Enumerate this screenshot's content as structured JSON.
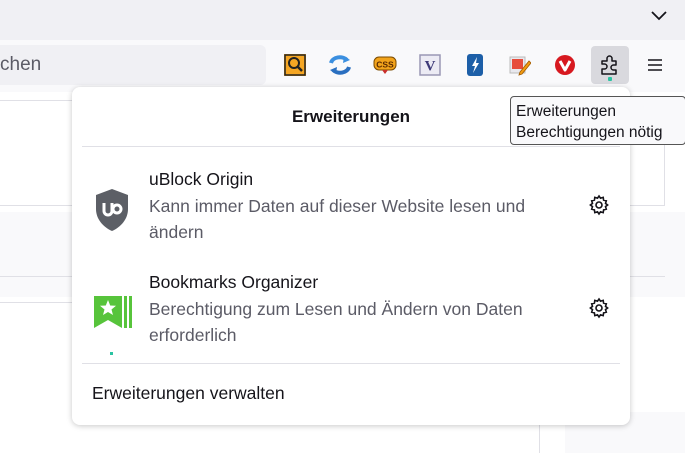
{
  "urlbar": {
    "placeholder": "chen"
  },
  "toolbar": {
    "icons": [
      "magnifier-extension-icon",
      "sync-arrows-icon",
      "css-extension-icon",
      "v-extension-icon",
      "bolt-extension-icon",
      "edit-extension-icon",
      "vivaldi-extension-icon",
      "puzzle-piece-icon",
      "hamburger-menu-icon"
    ]
  },
  "panel": {
    "title": "Erweiterungen",
    "extensions": [
      {
        "name": "uBlock Origin",
        "description": "Kann immer Daten auf dieser Website lesen und ändern",
        "icon": "ublock-shield-icon"
      },
      {
        "name": "Bookmarks Organizer",
        "description": "Berechtigung zum Lesen und Ändern von Daten erforderlich",
        "icon": "bookmark-star-icon"
      }
    ],
    "manage_label": "Erweiterungen verwalten"
  },
  "tooltip": {
    "line1": "Erweiterungen",
    "line2": "Berechtigungen nötig"
  },
  "colors": {
    "accent_dot": "#2ac3a2",
    "ublock": "#5c5f66",
    "bookmarks": "#57c43b"
  }
}
